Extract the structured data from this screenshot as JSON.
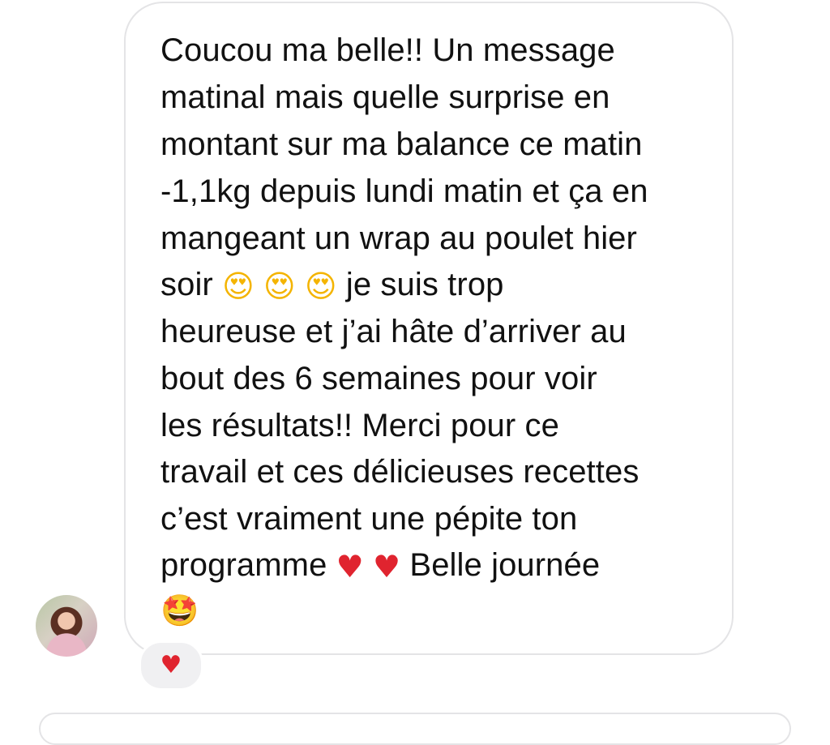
{
  "message": {
    "lines": [
      "Coucou ma belle!! Un message",
      "matinal mais quelle surprise en",
      "montant sur ma balance ce matin",
      "-1,1kg depuis lundi matin et ça en",
      "mangeant un wrap au poulet hier",
      "soir",
      "je suis trop",
      "heureuse et j’ai hâte d’arriver au",
      "bout des 6 semaines pour voir",
      "les résultats!! Merci pour ce",
      "travail et ces délicieuses recettes",
      "c’est vraiment une pépite ton",
      "programme",
      "Belle journée"
    ],
    "emojis": {
      "heart_eyes": "😍",
      "red_heart": "♥",
      "star_struck": "🤩"
    }
  },
  "reaction": {
    "emoji": "♥"
  },
  "icons": {
    "avatar": "profile-photo",
    "reaction": "red-heart-icon"
  },
  "colors": {
    "bubble_border": "#e4e4e6",
    "text": "#111111",
    "heart": "#e0242f",
    "reaction_bg": "#f0f0f2"
  }
}
